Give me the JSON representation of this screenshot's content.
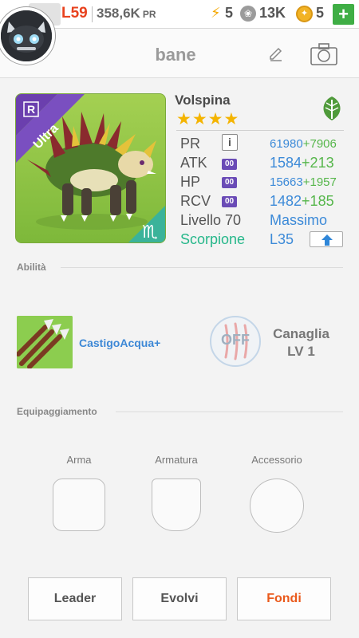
{
  "topbar": {
    "level": "L59",
    "pr_total": "358,6K",
    "pr_unit": "PR",
    "energy": "5",
    "paws": "13K",
    "coins": "5",
    "plus": "+"
  },
  "header": {
    "title": "bane"
  },
  "monster": {
    "name": "Volspina",
    "stars": "★★★★",
    "rank_badge": "R",
    "rarity": "Ultra",
    "zodiac_symbol": "♏",
    "element_icon": "leaf-icon",
    "stats": {
      "pr_label": "PR",
      "pr_info": "i",
      "pr_value": "61980",
      "pr_plus": "+7906",
      "atk_label": "ATK",
      "atk_badge": "00",
      "atk_value": "1584",
      "atk_plus": "+213",
      "hp_label": "HP",
      "hp_badge": "00",
      "hp_value": "15663",
      "hp_plus": "+1957",
      "rcv_label": "RCV",
      "rcv_badge": "00",
      "rcv_value": "1482",
      "rcv_plus": "+185"
    },
    "level_label": "Livello 70",
    "level_state": "Massimo",
    "zodiac_name": "Scorpione",
    "zodiac_level": "L35"
  },
  "abilities": {
    "section_label": "Abilità",
    "active_skill": "CastigoAcqua+",
    "leader_state": "OFF",
    "leader_name": "Canaglia",
    "leader_level": "LV 1"
  },
  "equipment": {
    "section_label": "Equipaggiamento",
    "weapon": "Arma",
    "armor": "Armatura",
    "accessory": "Accessorio"
  },
  "buttons": {
    "leader": "Leader",
    "evolve": "Evolvi",
    "fuse": "Fondi"
  },
  "colors": {
    "level_red": "#e8421e",
    "stat_blue": "#3c8ad8",
    "plus_green": "#55b64a",
    "zodiac_teal": "#26b78a",
    "fuse_orange": "#ea5a1c",
    "card_green": "#8fc53e"
  }
}
